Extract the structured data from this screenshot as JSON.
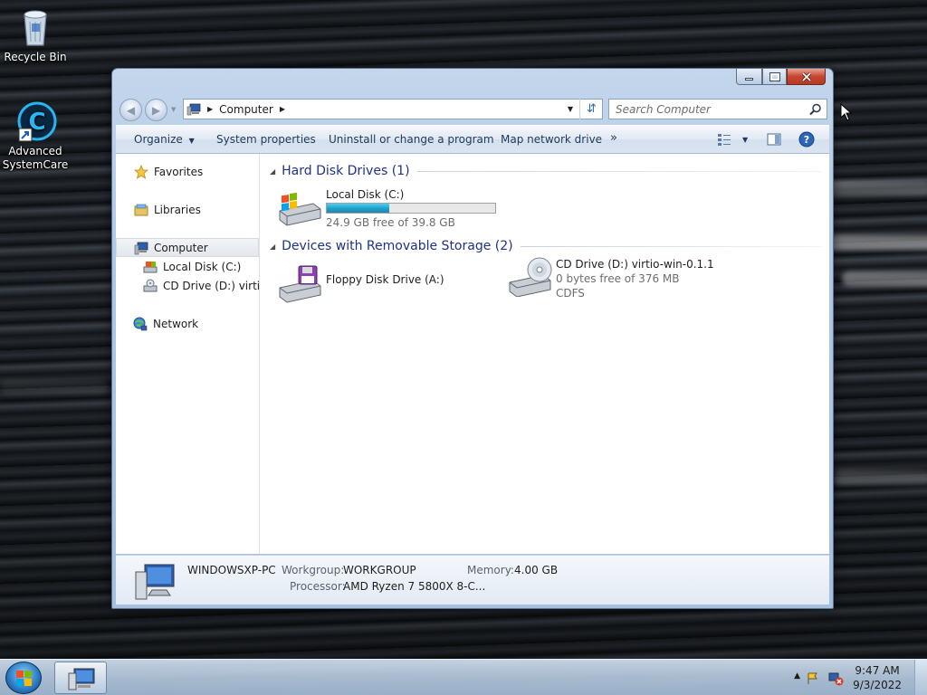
{
  "desktop": {
    "icons": [
      {
        "label": "Recycle Bin"
      },
      {
        "label": "Advanced\nSystemCare"
      }
    ]
  },
  "window": {
    "address": {
      "path_item": "Computer"
    },
    "search": {
      "placeholder": "Search Computer"
    },
    "toolbar": {
      "organize": "Organize",
      "system_properties": "System properties",
      "uninstall": "Uninstall or change a program",
      "map_drive": "Map network drive",
      "more": "»"
    },
    "nav": {
      "favorites": "Favorites",
      "libraries": "Libraries",
      "computer": "Computer",
      "local_disk": "Local Disk (C:)",
      "cd_drive": "CD Drive (D:) virtio-w",
      "network": "Network"
    },
    "groups": {
      "hdd": {
        "title": "Hard Disk Drives (1)",
        "drives": [
          {
            "name": "Local Disk (C:)",
            "free": "24.9 GB free of 39.8 GB",
            "used_fraction": 0.37
          }
        ]
      },
      "removable": {
        "title": "Devices with Removable Storage (2)",
        "drives": [
          {
            "name": "Floppy Disk Drive (A:)"
          },
          {
            "name": "CD Drive (D:) virtio-win-0.1.1",
            "free": "0 bytes free of 376 MB",
            "fs": "CDFS"
          }
        ]
      }
    },
    "details": {
      "computer_name": "WINDOWSXP-PC",
      "workgroup_label": "Workgroup:",
      "workgroup": "WORKGROUP",
      "memory_label": "Memory:",
      "memory": "4.00 GB",
      "processor_label": "Processor:",
      "processor": "AMD Ryzen 7 5800X 8-C..."
    }
  },
  "taskbar": {
    "time": "9:47 AM",
    "date": "9/3/2022"
  },
  "colors": {
    "group_header": "#1e3287",
    "progress_fill": "#1c9fc9",
    "close_button": "#c74530"
  }
}
